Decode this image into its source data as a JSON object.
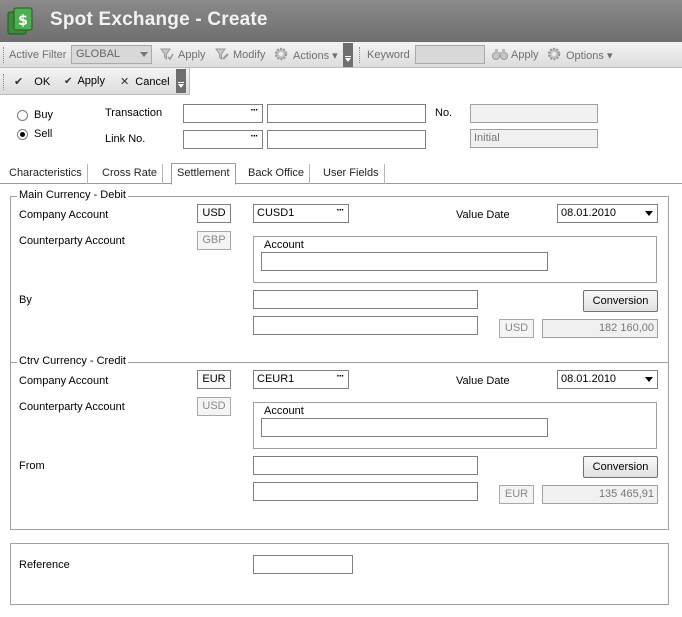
{
  "window": {
    "title": "Spot Exchange - Create",
    "app_icon": "currency-exchange-icon"
  },
  "toolbar": {
    "active_filter_label": "Active Filter",
    "active_filter_value": "GLOBAL",
    "apply_label": "Apply",
    "modify_label": "Modify",
    "actions_label": "Actions",
    "keyword_label": "Keyword",
    "keyword_value": "",
    "keyword_apply_label": "Apply",
    "options_label": "Options"
  },
  "action_bar": {
    "ok_label": "OK",
    "apply_label": "Apply",
    "cancel_label": "Cancel"
  },
  "header": {
    "buy_label": "Buy",
    "sell_label": "Sell",
    "selected_side": "Sell",
    "transaction_label": "Transaction",
    "transaction_code": "",
    "transaction_desc": "",
    "link_no_label": "Link No.",
    "link_no_code": "",
    "link_no_desc": "",
    "no_label": "No.",
    "no_value": "",
    "status_value": "Initial"
  },
  "tabs": [
    {
      "label": "Characteristics",
      "active": false
    },
    {
      "label": "Cross Rate",
      "active": false
    },
    {
      "label": "Settlement",
      "active": true
    },
    {
      "label": "Back Office",
      "active": false
    },
    {
      "label": "User Fields",
      "active": false
    }
  ],
  "debit": {
    "legend": "Main Currency - Debit",
    "company_account_label": "Company Account",
    "company_currency": "USD",
    "company_account_value": "CUSD1",
    "value_date_label": "Value Date",
    "value_date": "08.01.2010",
    "counterparty_account_label": "Counterparty Account",
    "counterparty_currency": "GBP",
    "account_label": "Account",
    "account_value": "",
    "by_label": "By",
    "by_value_1": "",
    "by_value_2": "",
    "conversion_label": "Conversion",
    "amount_currency": "USD",
    "amount": "182 160,00"
  },
  "credit": {
    "legend": "Ctrv Currency - Credit",
    "company_account_label": "Company Account",
    "company_currency": "EUR",
    "company_account_value": "CEUR1",
    "value_date_label": "Value Date",
    "value_date": "08.01.2010",
    "counterparty_account_label": "Counterparty Account",
    "counterparty_currency": "USD",
    "account_label": "Account",
    "account_value": "",
    "from_label": "From",
    "from_value_1": "",
    "from_value_2": "",
    "conversion_label": "Conversion",
    "amount_currency": "EUR",
    "amount": "135 465,91"
  },
  "reference": {
    "label": "Reference",
    "value": ""
  },
  "colors": {
    "titlebar": "#6e6e6e",
    "title_text": "#f2f2f2",
    "toolbar": "#dcdcdc",
    "border": "#a0a0a0"
  }
}
